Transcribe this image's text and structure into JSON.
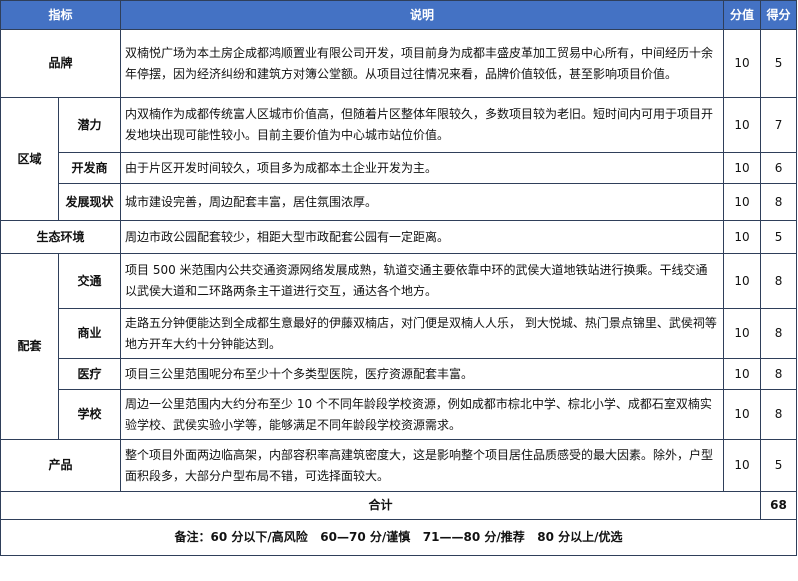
{
  "headers": {
    "indicator": "指标",
    "description": "说明",
    "score_value": "分值",
    "score_get": "得分"
  },
  "rows": {
    "brand": {
      "label": "品牌",
      "desc": "双楠悦广场为本土房企成都鸿顺置业有限公司开发，项目前身为成都丰盛皮革加工贸易中心所有，中间经历十余年停摆，因为经济纠纷和建筑方对簿公堂额。从项目过往情况来看，品牌价值较低，甚至影响项目价值。",
      "value": "10",
      "score": "5"
    },
    "region": {
      "label": "区域",
      "potential": {
        "label": "潜力",
        "desc": "内双楠作为成都传统富人区城市价值高，但随着片区整体年限较久，多数项目较为老旧。短时间内可用于项目开发地块出现可能性较小。目前主要价值为中心城市站位价值。",
        "value": "10",
        "score": "7"
      },
      "developer": {
        "label": "开发商",
        "desc": "由于片区开发时间较久，项目多为成都本土企业开发为主。",
        "value": "10",
        "score": "6"
      },
      "status": {
        "label": "发展现状",
        "desc": "城市建设完善，周边配套丰富，居住氛围浓厚。",
        "value": "10",
        "score": "8"
      }
    },
    "eco": {
      "label": "生态环境",
      "desc": "周边市政公园配套较少，相距大型市政配套公园有一定距离。",
      "value": "10",
      "score": "5"
    },
    "support": {
      "label": "配套",
      "traffic": {
        "label": "交通",
        "desc": "项目 500 米范围内公共交通资源网络发展成熟，轨道交通主要依靠中环的武侯大道地铁站进行换乘。干线交通以武侯大道和二环路两条主干道进行交互，通达各个地方。",
        "value": "10",
        "score": "8"
      },
      "commerce": {
        "label": "商业",
        "desc": "走路五分钟便能达到全成都生意最好的伊藤双楠店，对门便是双楠人人乐， 到大悦城、热门景点锦里、武侯祠等地方开车大约十分钟能达到。",
        "value": "10",
        "score": "8"
      },
      "medical": {
        "label": "医疗",
        "desc": "项目三公里范围呢分布至少十个多类型医院，医疗资源配套丰富。",
        "value": "10",
        "score": "8"
      },
      "school": {
        "label": "学校",
        "desc": "周边一公里范围内大约分布至少 10 个不同年龄段学校资源，例如成都市棕北中学、棕北小学、成都石室双楠实验学校、武侯实验小学等，能够满足不同年龄段学校资源需求。",
        "value": "10",
        "score": "8"
      }
    },
    "product": {
      "label": "产品",
      "desc": "整个项目外面两边临高架，内部容积率高建筑密度大，这是影响整个项目居住品质感受的最大因素。除外，户型面积段多，大部分户型布局不错，可选择面较大。",
      "value": "10",
      "score": "5"
    }
  },
  "total": {
    "label": "合计",
    "score": "68"
  },
  "note": "备注：60 分以下/高风险   60—70 分/谨慎   71——80 分/推荐   80 分以上/优选"
}
